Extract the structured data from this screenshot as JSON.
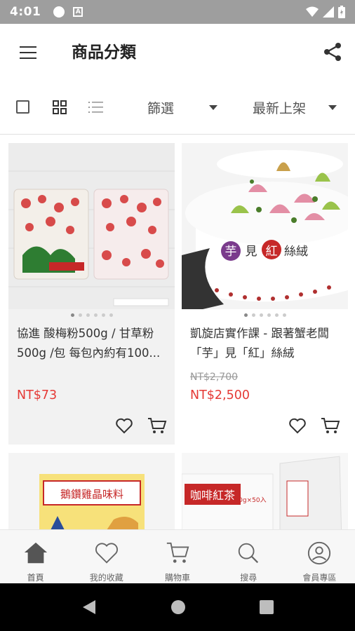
{
  "status_bar": {
    "time": "4:01",
    "a_icon": "A"
  },
  "app_bar": {
    "title": "商品分類"
  },
  "filter_bar": {
    "filter_label": "篩選",
    "sort_label": "最新上架"
  },
  "products": [
    {
      "title": "協進 酸梅粉500g / 甘草粉500g /包 每包內約有100...",
      "price_old": "",
      "price": "NT$73",
      "image": "plum-powder-bags"
    },
    {
      "title": "凱旋店實作課 - 跟著蟹老闆「芋」見「紅」絲絨",
      "price_old": "NT$2,700",
      "price": "NT$2,500",
      "image": "taro-red-velvet-cake",
      "image_caption": "芋見紅絲絨"
    },
    {
      "title": "",
      "price_old": "",
      "price": "",
      "image": "seasoning-bag",
      "image_caption": "鵝鑽雞晶味料"
    },
    {
      "title": "",
      "price_old": "",
      "price": "",
      "image": "coffee-tea-bags",
      "image_caption": "咖啡紅茶",
      "image_subcaption": "60g×50入"
    }
  ],
  "bottom_nav": [
    {
      "label": "首頁",
      "icon": "home-icon"
    },
    {
      "label": "我的收藏",
      "icon": "heart-icon"
    },
    {
      "label": "購物車",
      "icon": "cart-icon"
    },
    {
      "label": "搜尋",
      "icon": "search-icon"
    },
    {
      "label": "會員專區",
      "icon": "user-icon"
    }
  ],
  "colors": {
    "price_red": "#e53935",
    "status_bar": "#9e9e9e",
    "card_bg": "#f2f2f2"
  }
}
